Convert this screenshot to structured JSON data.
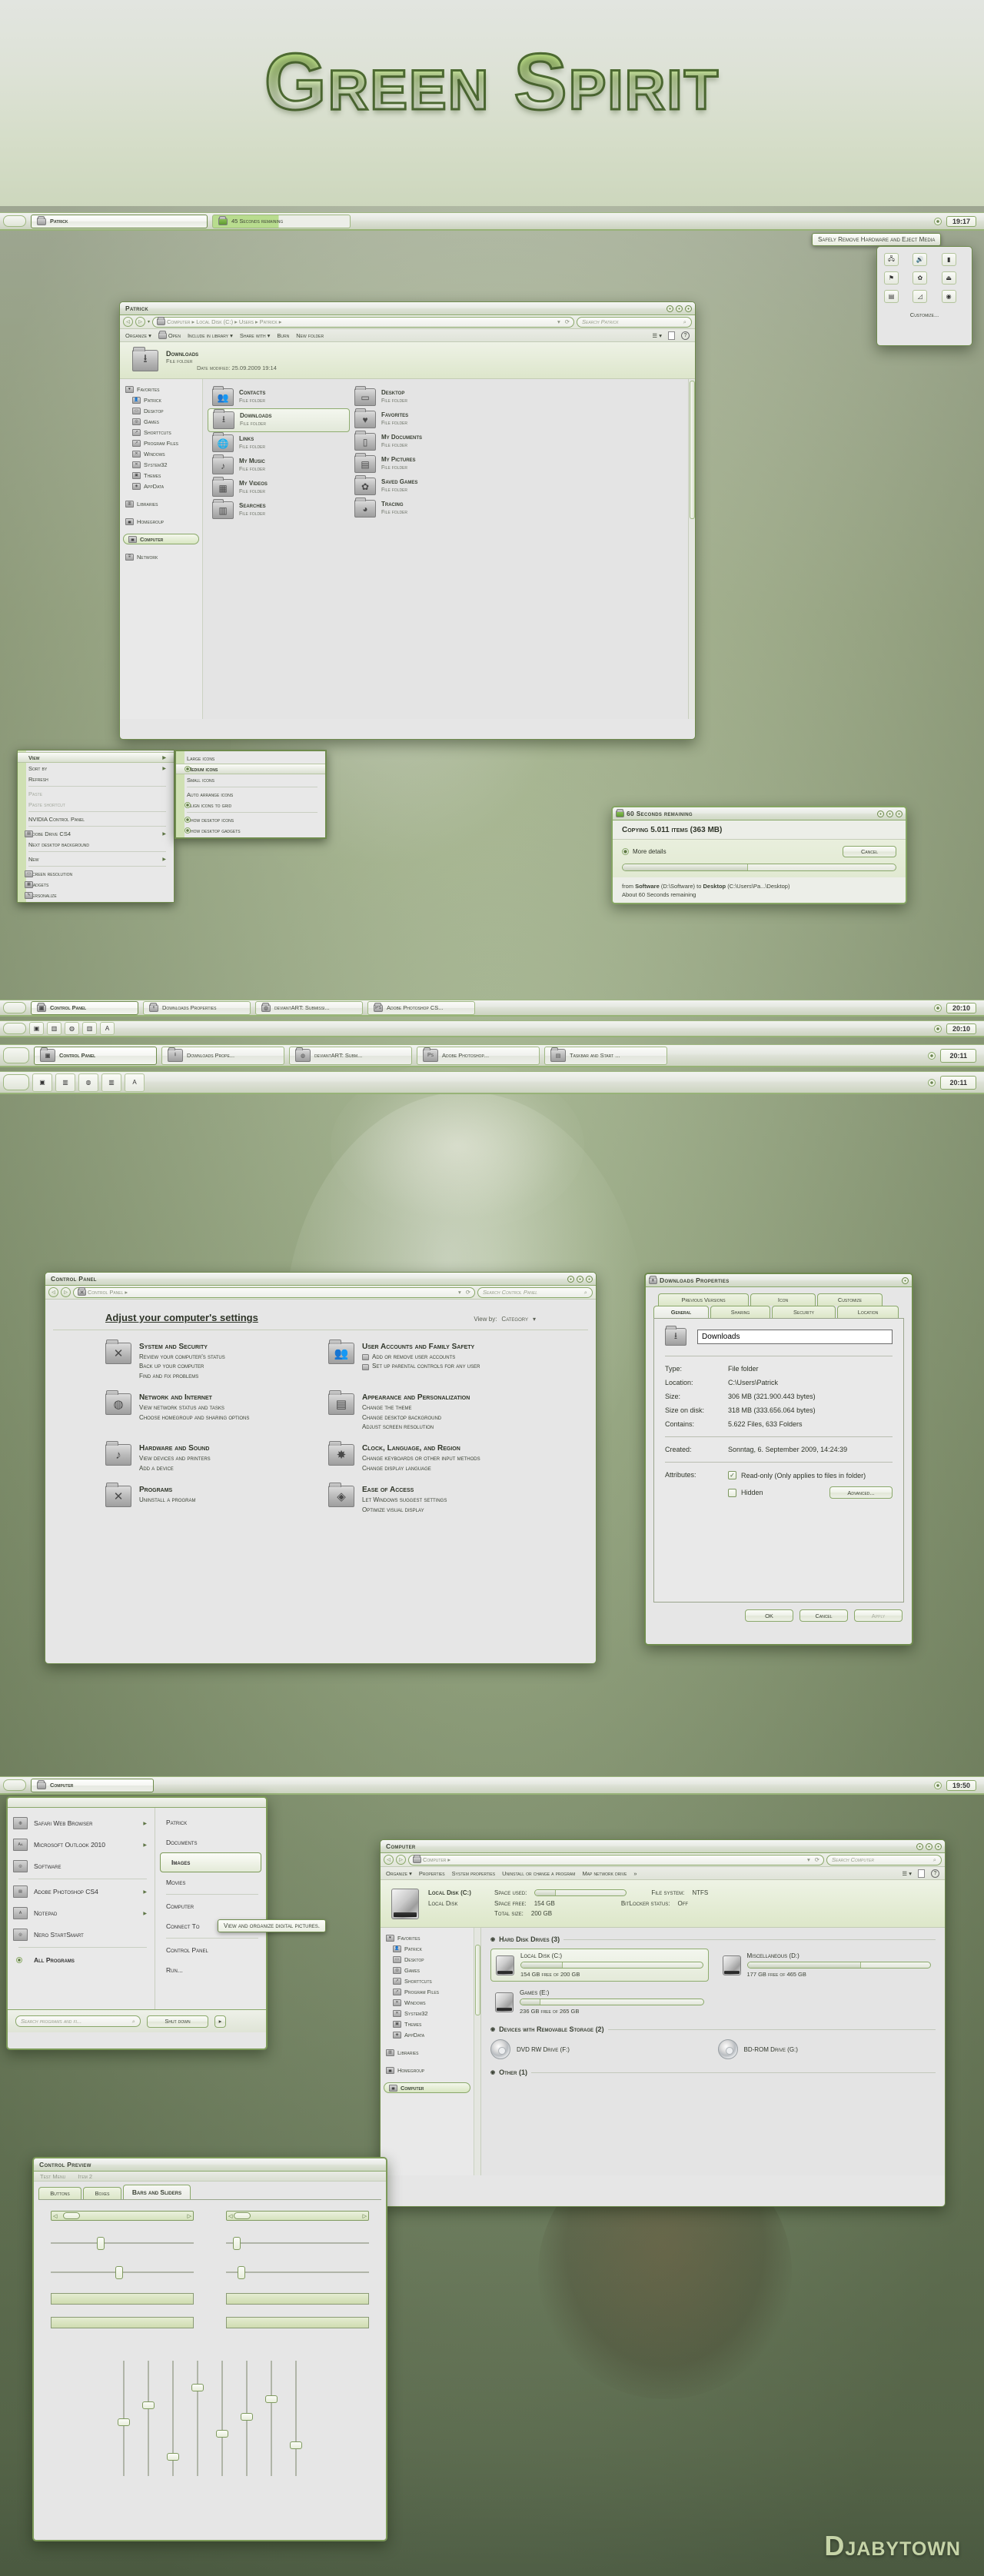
{
  "banner": {
    "title": "Green Spirit"
  },
  "watermark": {
    "text": "Djabytown"
  },
  "taskbar_top": {
    "tasks": [
      {
        "label": "Patrick",
        "icon": "folder-icon",
        "state": "active"
      },
      {
        "label": "45 Seconds remaining",
        "icon": "copy-icon",
        "state": "progress"
      }
    ],
    "clock": "19:17",
    "tray_icon": "show-hidden-icons"
  },
  "tray_tooltip": {
    "text": "Safely Remove Hardware and Eject Media"
  },
  "tray_flyout": {
    "customize_label": "Customize...",
    "icons": [
      "network-icon",
      "volume-icon",
      "battery-icon",
      "shield-icon",
      "flag-icon",
      "eject-icon",
      "photo-icon",
      "chart-icon",
      "disc-icon"
    ]
  },
  "explorer_patrick": {
    "title": "Patrick",
    "breadcrumb": [
      "Computer",
      "Local Disk (C:)",
      "Users",
      "Patrick"
    ],
    "search_placeholder": "Search Patrick",
    "toolbar": [
      "Organize",
      "Open",
      "Include in library",
      "Share with",
      "Burn",
      "New folder"
    ],
    "header": {
      "name": "Downloads",
      "type": "File folder",
      "date_label": "Date modified:",
      "date_value": "25.09.2009 19:14"
    },
    "sidebar": [
      {
        "label": "Favorites",
        "icon": "favorites-icon",
        "level": 0
      },
      {
        "label": "Patrick",
        "icon": "user-folder-icon",
        "level": 1
      },
      {
        "label": "Desktop",
        "icon": "desktop-icon",
        "level": 1
      },
      {
        "label": "Games",
        "icon": "games-icon",
        "level": 1
      },
      {
        "label": "Shorttcuts",
        "icon": "shortcut-icon",
        "level": 1
      },
      {
        "label": "Program Files",
        "icon": "program-icon",
        "level": 1
      },
      {
        "label": "Windows",
        "icon": "windows-icon",
        "level": 1
      },
      {
        "label": "System32",
        "icon": "system-icon",
        "level": 1
      },
      {
        "label": "Themes",
        "icon": "themes-icon",
        "level": 1
      },
      {
        "label": "AppData",
        "icon": "appdata-icon",
        "level": 1
      },
      {
        "label": "Libraries",
        "icon": "libraries-icon",
        "level": 0,
        "gap": true
      },
      {
        "label": "Homegroup",
        "icon": "homegroup-icon",
        "level": 0,
        "gap": true
      },
      {
        "label": "Computer",
        "icon": "computer-icon",
        "level": 0,
        "gap": true,
        "selected": true
      },
      {
        "label": "Network",
        "icon": "network-icon",
        "level": 0,
        "gap": true
      }
    ],
    "files_col1": [
      {
        "name": "Contacts",
        "type": "File folder",
        "icon": "contacts-icon"
      },
      {
        "name": "Downloads",
        "type": "File folder",
        "icon": "download-icon",
        "selected": true
      },
      {
        "name": "Links",
        "type": "File folder",
        "icon": "globe-icon"
      },
      {
        "name": "My Music",
        "type": "File folder",
        "icon": "music-icon"
      },
      {
        "name": "My Videos",
        "type": "File folder",
        "icon": "video-icon"
      },
      {
        "name": "Searches",
        "type": "File folder",
        "icon": "search-folder-icon"
      }
    ],
    "files_col2": [
      {
        "name": "Desktop",
        "type": "File folder",
        "icon": "desktop-icon"
      },
      {
        "name": "Favorites",
        "type": "File folder",
        "icon": "heart-icon"
      },
      {
        "name": "My Documents",
        "type": "File folder",
        "icon": "document-icon"
      },
      {
        "name": "My Pictures",
        "type": "File folder",
        "icon": "picture-icon"
      },
      {
        "name": "Saved Games",
        "type": "File folder",
        "icon": "gear-icon"
      },
      {
        "name": "Tracing",
        "type": "File folder",
        "icon": "tracing-icon"
      }
    ]
  },
  "context_menu": {
    "items": [
      {
        "label": "View",
        "submenu": true,
        "highlight": true
      },
      {
        "label": "Sort by",
        "submenu": true
      },
      {
        "label": "Refresh"
      },
      {
        "sep": true
      },
      {
        "label": "Paste",
        "disabled": true
      },
      {
        "label": "Paste shortcut",
        "disabled": true
      },
      {
        "sep": true
      },
      {
        "label": "NVIDIA Control Panel"
      },
      {
        "sep": true
      },
      {
        "label": "Adobe Drive CS4",
        "submenu": true,
        "icon": "adobe-icon"
      },
      {
        "label": "Next desktop background"
      },
      {
        "sep": true
      },
      {
        "label": "New",
        "submenu": true
      },
      {
        "sep": true
      },
      {
        "label": "Screen resolution",
        "icon": "screen-icon"
      },
      {
        "label": "Gadgets",
        "icon": "gadgets-icon"
      },
      {
        "label": "Personalize",
        "icon": "personalize-icon"
      }
    ]
  },
  "view_submenu": {
    "items": [
      {
        "label": "Large icons"
      },
      {
        "label": "Medium icons",
        "radio": true,
        "highlight": true
      },
      {
        "label": "Small icons"
      },
      {
        "sep": true
      },
      {
        "label": "Auto arrange icons"
      },
      {
        "label": "Align icons to grid",
        "radio": true
      },
      {
        "sep": true
      },
      {
        "label": "Show desktop icons",
        "radio": true
      },
      {
        "label": "Show desktop gadgets",
        "radio": true
      }
    ]
  },
  "copy_dialog": {
    "title": "60 Seconds remaining",
    "heading": "Copying 5.011 items (363 MB)",
    "more_details": "More details",
    "cancel": "Cancel",
    "progress_percent": 46,
    "line1_prefix": "from",
    "line1_src": "Software",
    "line1_srcpath": "(D:\\Software)",
    "line1_mid": "to",
    "line1_dst": "Desktop",
    "line1_dstpath": "(C:\\Users\\Pa...\\Desktop)",
    "line2": "About 60 Seconds remaining"
  },
  "taskbars_mid": [
    {
      "tasks": [
        {
          "label": "Control Panel",
          "icon": "control-panel-icon",
          "state": "active"
        },
        {
          "label": "Downloads Properties",
          "icon": "download-icon"
        },
        {
          "label": "deviantART: Submissi...",
          "icon": "safari-icon"
        },
        {
          "label": "Adobe Photoshop CS...",
          "icon": "photoshop-icon"
        }
      ],
      "clock": "20:10",
      "style": "small"
    },
    {
      "quicklaunch": [
        "media-icon",
        "libraries-icon",
        "safari-icon",
        "explorer-icon",
        "notepad-icon"
      ],
      "clock": "20:10",
      "style": "small-icons"
    },
    {
      "tasks": [
        {
          "label": "Control Panel",
          "icon": "control-panel-icon",
          "state": "active"
        },
        {
          "label": "Downloads Prope...",
          "icon": "download-icon"
        },
        {
          "label": "deviantART: Subm...",
          "icon": "safari-icon"
        },
        {
          "label": "Adobe Photoshop...",
          "icon": "photoshop-icon"
        },
        {
          "label": "Taskbar and Start ...",
          "icon": "taskbar-icon"
        }
      ],
      "clock": "20:11",
      "style": "large"
    },
    {
      "quicklaunch": [
        "media-icon",
        "libraries-icon",
        "safari-icon",
        "explorer-icon",
        "notepad-icon"
      ],
      "clock": "20:11",
      "style": "large-icons"
    }
  ],
  "control_panel": {
    "title": "Control Panel",
    "breadcrumb": [
      "Control Panel"
    ],
    "search_placeholder": "Search Control Panel",
    "heading": "Adjust your computer's settings",
    "viewby_label": "View by:",
    "viewby_value": "Category",
    "categories": [
      {
        "title": "System and Security",
        "icon": "system-icon",
        "links": [
          "Review your computer's status",
          "Back up your computer",
          "Find and fix problems"
        ]
      },
      {
        "title": "User Accounts and Family Safety",
        "icon": "users-icon",
        "links": [
          "Add or remove user accounts",
          "Set up parental controls for any user"
        ],
        "sublinkicons": true
      },
      {
        "title": "Network and Internet",
        "icon": "network-globe-icon",
        "links": [
          "View network status and tasks",
          "Choose homegroup and sharing options"
        ]
      },
      {
        "title": "Appearance and Personalization",
        "icon": "picture-icon",
        "links": [
          "Change the theme",
          "Change desktop background",
          "Adjust screen resolution"
        ]
      },
      {
        "title": "Hardware and Sound",
        "icon": "hardware-icon",
        "links": [
          "View devices and printers",
          "Add a device"
        ]
      },
      {
        "title": "Clock, Language, and Region",
        "icon": "clock-icon",
        "links": [
          "Change keyboards or other input methods",
          "Change display language"
        ]
      },
      {
        "title": "Programs",
        "icon": "programs-icon",
        "links": [
          "Uninstall a program"
        ]
      },
      {
        "title": "Ease of Access",
        "icon": "access-icon",
        "links": [
          "Let Windows suggest settings",
          "Optimize visual display"
        ]
      }
    ]
  },
  "properties_dialog": {
    "title": "Downloads Properties",
    "tabs_row1": [
      "Previous Versions",
      "Icon",
      "Customize"
    ],
    "tabs_row2": [
      "General",
      "Sharing",
      "Security",
      "Location"
    ],
    "active_tab": "General",
    "name_value": "Downloads",
    "rows": [
      {
        "label": "Type:",
        "value": "File folder"
      },
      {
        "label": "Location:",
        "value": "C:\\Users\\Patrick"
      },
      {
        "label": "Size:",
        "value": "306 MB (321.900.443 bytes)"
      },
      {
        "label": "Size on disk:",
        "value": "318 MB (333.656.064 bytes)"
      },
      {
        "label": "Contains:",
        "value": "5.622 Files, 633 Folders"
      }
    ],
    "created_label": "Created:",
    "created_value": "Sonntag, 6. September 2009, 14:24:39",
    "attributes_label": "Attributes:",
    "attr_readonly": "Read-only (Only applies to files in folder)",
    "attr_readonly_checked": true,
    "attr_hidden": "Hidden",
    "attr_hidden_checked": false,
    "advanced_button": "Advanced...",
    "buttons": [
      "OK",
      "Cancel",
      "Apply"
    ]
  },
  "taskbar_computer": {
    "tasks": [
      {
        "label": "Computer",
        "icon": "computer-icon",
        "state": "active"
      }
    ],
    "clock": "19:50"
  },
  "start_menu": {
    "programs": [
      {
        "label": "Safari Web Browser",
        "icon": "safari-icon",
        "submenu": true
      },
      {
        "label": "Microsoft Outlook 2010",
        "icon": "outlook-icon",
        "submenu": true
      },
      {
        "label": "Software",
        "icon": "software-icon"
      },
      {
        "sep": true
      },
      {
        "label": "Adobe Photoshop CS4",
        "icon": "photoshop-folder-icon",
        "submenu": true
      },
      {
        "label": "Notepad",
        "icon": "notepad-icon",
        "submenu": true
      },
      {
        "label": "Nero StartSmart",
        "icon": "nero-icon"
      },
      {
        "sep": true
      },
      {
        "label": "All Programs",
        "radio": true,
        "bold": true
      }
    ],
    "places": [
      {
        "label": "Patrick"
      },
      {
        "label": "Documents"
      },
      {
        "label": "Images",
        "selected": true
      },
      {
        "label": "Movies"
      },
      {
        "sep": true
      },
      {
        "label": "Computer"
      },
      {
        "label": "Connect To"
      },
      {
        "sep": true
      },
      {
        "label": "Control Panel"
      },
      {
        "label": "Run..."
      }
    ],
    "tooltip": "View and organize digital pictures.",
    "search_placeholder": "Search programs and fi...",
    "shutdown_label": "Shut down"
  },
  "computer_window": {
    "title": "Computer",
    "breadcrumb": [
      "Computer"
    ],
    "search_placeholder": "Search Computer",
    "toolbar": [
      "Organize",
      "Properties",
      "System properties",
      "Uninstall or change a program",
      "Map network drive"
    ],
    "detail": {
      "name": "Local Disk (C:)",
      "subtitle": "Local Disk",
      "space_used_label": "Space used:",
      "space_free_label": "Space free:",
      "space_free": "154 GB",
      "total_label": "Total size:",
      "total": "200 GB",
      "filesystem_label": "File system:",
      "filesystem": "NTFS",
      "bitlocker_label": "BitLocker status:",
      "bitlocker": "Off",
      "used_percent": 23
    },
    "sidebar": [
      {
        "label": "Favorites",
        "icon": "favorites-icon",
        "level": 0
      },
      {
        "label": "Patrick",
        "icon": "user-folder-icon",
        "level": 1
      },
      {
        "label": "Desktop",
        "icon": "desktop-icon",
        "level": 1
      },
      {
        "label": "Games",
        "icon": "games-icon",
        "level": 1
      },
      {
        "label": "Shorttcuts",
        "icon": "shortcut-icon",
        "level": 1
      },
      {
        "label": "Program Files",
        "icon": "program-icon",
        "level": 1
      },
      {
        "label": "Windows",
        "icon": "windows-icon",
        "level": 1
      },
      {
        "label": "System32",
        "icon": "system-icon",
        "level": 1
      },
      {
        "label": "Themes",
        "icon": "themes-icon",
        "level": 1
      },
      {
        "label": "AppData",
        "icon": "appdata-icon",
        "level": 1
      },
      {
        "label": "Libraries",
        "icon": "libraries-icon",
        "level": 0,
        "gap": true
      },
      {
        "label": "Homegroup",
        "icon": "homegroup-icon",
        "level": 0,
        "gap": true
      },
      {
        "label": "Computer",
        "icon": "computer-icon",
        "level": 0,
        "gap": true,
        "selected": true
      }
    ],
    "group_hdd": "Hard Disk Drives (3)",
    "drives": [
      {
        "name": "Local Disk (C:)",
        "free": "154 GB free of 200 GB",
        "percent": 23,
        "selected": true
      },
      {
        "name": "Miscellaneous (D:)",
        "free": "177 GB free of 465 GB",
        "percent": 62
      },
      {
        "name": "Games (E:)",
        "free": "236 GB free of 265 GB",
        "percent": 11
      }
    ],
    "group_removable": "Devices with Removable Storage (2)",
    "removable": [
      {
        "name": "DVD RW Drive (F:)"
      },
      {
        "name": "BD-ROM Drive (G:)"
      }
    ],
    "group_other": "Other (1)"
  },
  "control_preview": {
    "title": "Control Preview",
    "menu": [
      "Test Menu",
      "Item 2"
    ],
    "tabs": [
      "Buttons",
      "Boxes",
      "Bars and Sliders"
    ],
    "active_tab": "Bars and Sliders",
    "scrollbar_values": [
      8,
      2
    ],
    "slider_values": [
      32,
      5,
      45,
      8
    ],
    "progress_values": [
      100,
      100,
      100,
      100
    ],
    "vertical_slider_values": [
      50,
      35,
      80,
      20,
      60,
      45,
      30,
      70
    ]
  }
}
